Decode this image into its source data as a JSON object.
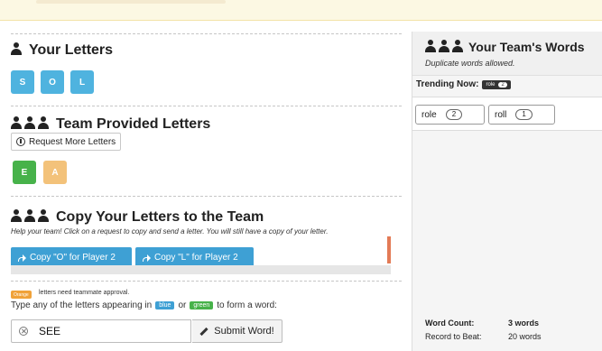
{
  "your_letters": {
    "title": "Your Letters",
    "tiles": [
      "S",
      "O",
      "L"
    ]
  },
  "team_provided": {
    "title": "Team Provided Letters",
    "request_button": "Request More Letters",
    "tiles": [
      {
        "letter": "E",
        "color": "#47b24a"
      },
      {
        "letter": "A",
        "color": "#f3c27a"
      }
    ]
  },
  "copy_section": {
    "title": "Copy Your Letters to the Team",
    "help": "Help your team! Click on a request to copy and send a letter. You will still have a copy of your letter.",
    "buttons": [
      "Copy \"O\" for Player 2",
      "Copy \"L\" for Player 2"
    ]
  },
  "submission": {
    "orange_badge": "Orange",
    "approval_note": "letters need teammate approval.",
    "instruction_prefix": "Type any of the letters appearing in",
    "blue_chip": "blue",
    "or": "or",
    "green_chip": "green",
    "instruction_suffix": "to form a word:",
    "input_value": "SEE",
    "submit_label": "Submit Word!"
  },
  "team_words": {
    "title": "Your Team's Words",
    "subtitle": "Duplicate words allowed.",
    "trending_label": "Trending Now:",
    "trending_word": "role",
    "trending_count": "2",
    "words": [
      {
        "word": "role",
        "count": "2"
      },
      {
        "word": "roll",
        "count": "1"
      }
    ],
    "word_count_label": "Word Count:",
    "word_count_value": "3 words",
    "record_label": "Record to Beat:",
    "record_value": "20 words"
  },
  "colors": {
    "blue": "#4fb3df",
    "green": "#47b24a",
    "orange": "#f3c27a",
    "notice_bg": "#fcf8e3"
  }
}
